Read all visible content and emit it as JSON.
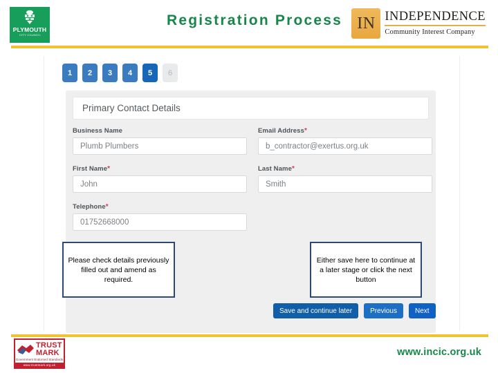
{
  "header": {
    "title": "Registration Process",
    "pcc_logo": {
      "name": "PLYMOUTH",
      "subtitle": "CITY COUNCIL",
      "icon": "plymouth-crest-icon",
      "color": "#179e5a"
    },
    "independence_logo": {
      "badge": "IN",
      "name": "INDEPENDENCE",
      "tagline": "Community Interest Company",
      "badge_color": "#e8a73f",
      "rule_color": "#e0b04a"
    },
    "rule_color": "#f1c232",
    "title_color": "#17864a"
  },
  "screenshot": {
    "steps": [
      {
        "label": "1",
        "state": "done"
      },
      {
        "label": "2",
        "state": "done"
      },
      {
        "label": "3",
        "state": "done"
      },
      {
        "label": "4",
        "state": "done"
      },
      {
        "label": "5",
        "state": "active"
      },
      {
        "label": "6",
        "state": "inactive"
      }
    ],
    "panel_title": "Primary Contact Details",
    "fields": [
      {
        "label": "Business Name",
        "required": false,
        "value": "Plumb Plumbers"
      },
      {
        "label": "Email Address",
        "required": true,
        "value": "b_contractor@exertus.org.uk"
      },
      {
        "label": "First Name",
        "required": true,
        "value": "John"
      },
      {
        "label": "Last Name",
        "required": true,
        "value": "Smith"
      },
      {
        "label": "Telephone",
        "required": true,
        "value": "01752668000"
      }
    ],
    "required_marker": "*",
    "buttons": {
      "save": "Save and continue later",
      "previous": "Previous",
      "next": "Next"
    },
    "accent_blue": "#1667b8"
  },
  "callouts": {
    "left": "Please check details previously filled out and amend as required.",
    "right": "Either save here to continue at a later stage or click the next button",
    "border_color": "#2a4a73"
  },
  "footer": {
    "trustmark": {
      "line1": "TRUST",
      "line2": "MARK",
      "tagline": "Government Endorsed Standards",
      "url": "www.trustmark.org.uk",
      "icon": "handshake-icon",
      "color": "#c3202f"
    },
    "website": "www.incic.org.uk",
    "rule_color": "#f1c232",
    "website_color": "#17864a"
  }
}
